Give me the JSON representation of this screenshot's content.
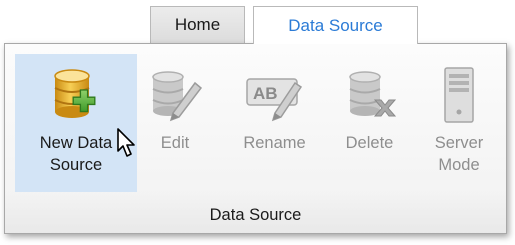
{
  "tabs": [
    {
      "label": "Home",
      "active": false
    },
    {
      "label": "Data Source",
      "active": true
    }
  ],
  "group": {
    "label": "Data Source",
    "buttons": [
      {
        "label": "New Data\nSource",
        "icon": "new-data-source-icon",
        "enabled": true,
        "hovered": true
      },
      {
        "label": "Edit",
        "icon": "edit-icon",
        "enabled": false
      },
      {
        "label": "Rename",
        "icon": "rename-icon",
        "enabled": false
      },
      {
        "label": "Delete",
        "icon": "delete-icon",
        "enabled": false
      },
      {
        "label": "Server\nMode",
        "icon": "server-mode-icon",
        "enabled": false
      }
    ]
  },
  "colors": {
    "active_tab_text": "#2b7bd6",
    "hover_background": "#d3e4f6",
    "disabled_text": "#8e8e8e"
  }
}
